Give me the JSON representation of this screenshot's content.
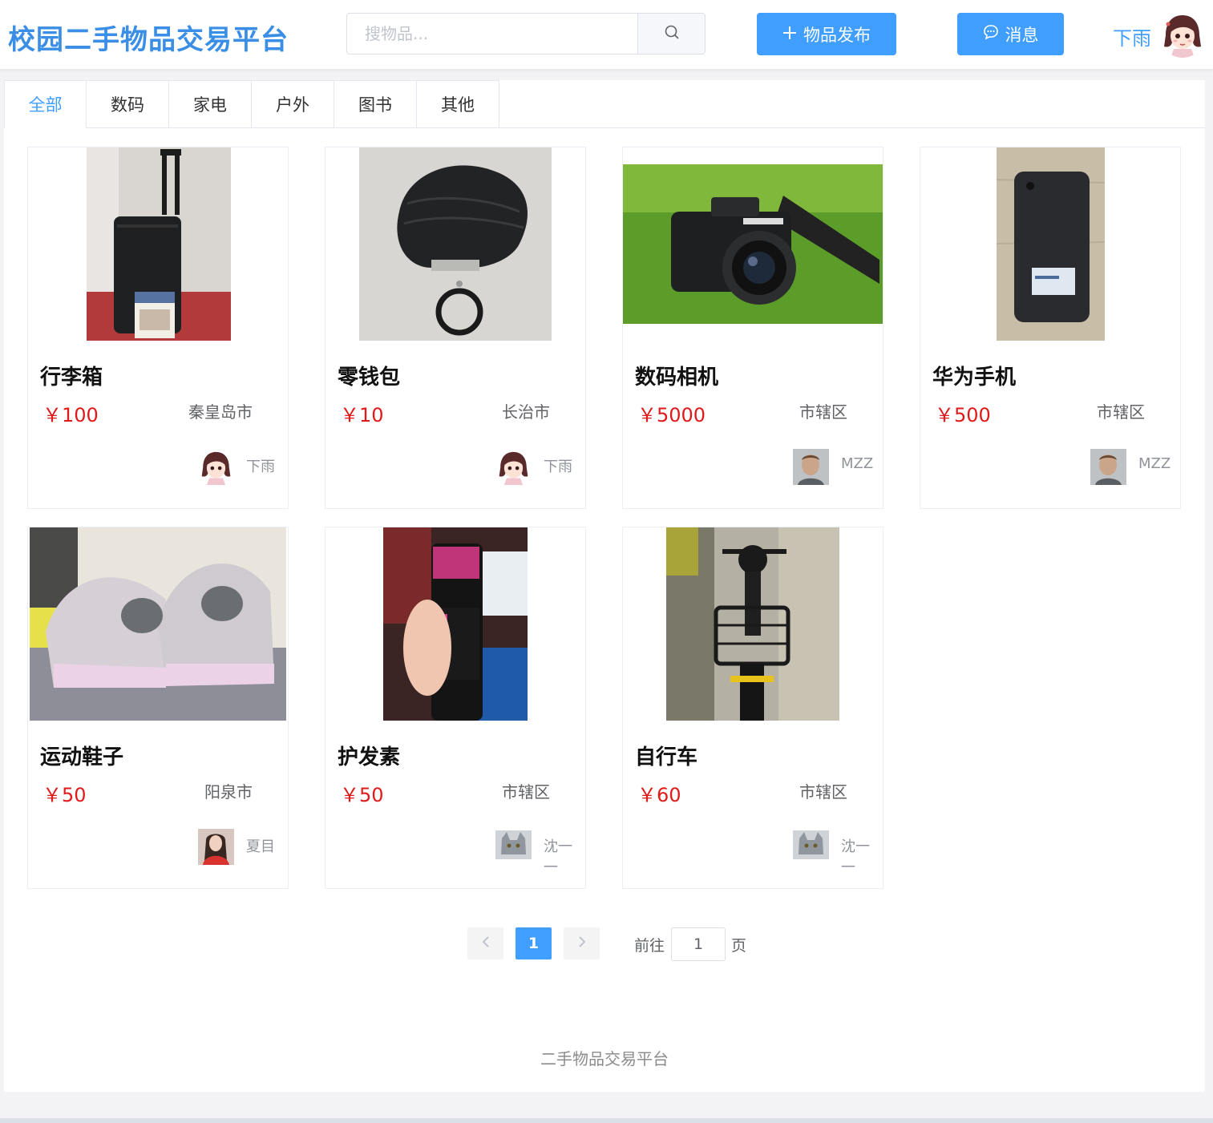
{
  "header": {
    "title": "校园二手物品交易平台",
    "search_placeholder": "搜物品...",
    "search_icon": "search-icon",
    "publish_label": "物品发布",
    "messages_label": "消息",
    "user_name": "下雨"
  },
  "tabs": [
    {
      "label": "全部",
      "active": true
    },
    {
      "label": "数码",
      "active": false
    },
    {
      "label": "家电",
      "active": false
    },
    {
      "label": "户外",
      "active": false
    },
    {
      "label": "图书",
      "active": false
    },
    {
      "label": "其他",
      "active": false
    }
  ],
  "items": [
    {
      "title": "行李箱",
      "price": "￥100",
      "location": "秦皇岛市",
      "seller": "下雨"
    },
    {
      "title": "零钱包",
      "price": "￥10",
      "location": "长治市",
      "seller": "下雨"
    },
    {
      "title": "数码相机",
      "price": "￥5000",
      "location": "市辖区",
      "seller": "MZZ"
    },
    {
      "title": "华为手机",
      "price": "￥500",
      "location": "市辖区",
      "seller": "MZZ"
    },
    {
      "title": "运动鞋子",
      "price": "￥50",
      "location": "阳泉市",
      "seller": "夏目"
    },
    {
      "title": "护发素",
      "price": "￥50",
      "location": "市辖区",
      "seller": "沈一一"
    },
    {
      "title": "自行车",
      "price": "￥60",
      "location": "市辖区",
      "seller": "沈一一"
    }
  ],
  "pagination": {
    "current_page": "1",
    "goto_label": "前往",
    "goto_value": "1",
    "page_suffix": "页"
  },
  "footer": {
    "text": "二手物品交易平台"
  },
  "colors": {
    "accent": "#409eff",
    "price": "#e01a1a",
    "logo": "#3a8ee6"
  }
}
